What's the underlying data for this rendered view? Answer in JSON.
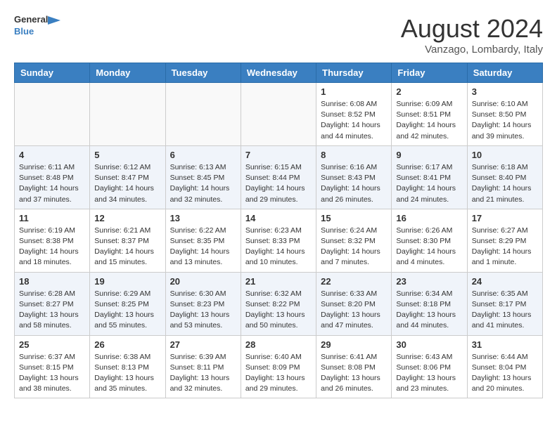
{
  "header": {
    "logo_line1": "General",
    "logo_line2": "Blue",
    "month_year": "August 2024",
    "location": "Vanzago, Lombardy, Italy"
  },
  "weekdays": [
    "Sunday",
    "Monday",
    "Tuesday",
    "Wednesday",
    "Thursday",
    "Friday",
    "Saturday"
  ],
  "weeks": [
    [
      {
        "day": "",
        "info": ""
      },
      {
        "day": "",
        "info": ""
      },
      {
        "day": "",
        "info": ""
      },
      {
        "day": "",
        "info": ""
      },
      {
        "day": "1",
        "info": "Sunrise: 6:08 AM\nSunset: 8:52 PM\nDaylight: 14 hours\nand 44 minutes."
      },
      {
        "day": "2",
        "info": "Sunrise: 6:09 AM\nSunset: 8:51 PM\nDaylight: 14 hours\nand 42 minutes."
      },
      {
        "day": "3",
        "info": "Sunrise: 6:10 AM\nSunset: 8:50 PM\nDaylight: 14 hours\nand 39 minutes."
      }
    ],
    [
      {
        "day": "4",
        "info": "Sunrise: 6:11 AM\nSunset: 8:48 PM\nDaylight: 14 hours\nand 37 minutes."
      },
      {
        "day": "5",
        "info": "Sunrise: 6:12 AM\nSunset: 8:47 PM\nDaylight: 14 hours\nand 34 minutes."
      },
      {
        "day": "6",
        "info": "Sunrise: 6:13 AM\nSunset: 8:45 PM\nDaylight: 14 hours\nand 32 minutes."
      },
      {
        "day": "7",
        "info": "Sunrise: 6:15 AM\nSunset: 8:44 PM\nDaylight: 14 hours\nand 29 minutes."
      },
      {
        "day": "8",
        "info": "Sunrise: 6:16 AM\nSunset: 8:43 PM\nDaylight: 14 hours\nand 26 minutes."
      },
      {
        "day": "9",
        "info": "Sunrise: 6:17 AM\nSunset: 8:41 PM\nDaylight: 14 hours\nand 24 minutes."
      },
      {
        "day": "10",
        "info": "Sunrise: 6:18 AM\nSunset: 8:40 PM\nDaylight: 14 hours\nand 21 minutes."
      }
    ],
    [
      {
        "day": "11",
        "info": "Sunrise: 6:19 AM\nSunset: 8:38 PM\nDaylight: 14 hours\nand 18 minutes."
      },
      {
        "day": "12",
        "info": "Sunrise: 6:21 AM\nSunset: 8:37 PM\nDaylight: 14 hours\nand 15 minutes."
      },
      {
        "day": "13",
        "info": "Sunrise: 6:22 AM\nSunset: 8:35 PM\nDaylight: 14 hours\nand 13 minutes."
      },
      {
        "day": "14",
        "info": "Sunrise: 6:23 AM\nSunset: 8:33 PM\nDaylight: 14 hours\nand 10 minutes."
      },
      {
        "day": "15",
        "info": "Sunrise: 6:24 AM\nSunset: 8:32 PM\nDaylight: 14 hours\nand 7 minutes."
      },
      {
        "day": "16",
        "info": "Sunrise: 6:26 AM\nSunset: 8:30 PM\nDaylight: 14 hours\nand 4 minutes."
      },
      {
        "day": "17",
        "info": "Sunrise: 6:27 AM\nSunset: 8:29 PM\nDaylight: 14 hours\nand 1 minute."
      }
    ],
    [
      {
        "day": "18",
        "info": "Sunrise: 6:28 AM\nSunset: 8:27 PM\nDaylight: 13 hours\nand 58 minutes."
      },
      {
        "day": "19",
        "info": "Sunrise: 6:29 AM\nSunset: 8:25 PM\nDaylight: 13 hours\nand 55 minutes."
      },
      {
        "day": "20",
        "info": "Sunrise: 6:30 AM\nSunset: 8:23 PM\nDaylight: 13 hours\nand 53 minutes."
      },
      {
        "day": "21",
        "info": "Sunrise: 6:32 AM\nSunset: 8:22 PM\nDaylight: 13 hours\nand 50 minutes."
      },
      {
        "day": "22",
        "info": "Sunrise: 6:33 AM\nSunset: 8:20 PM\nDaylight: 13 hours\nand 47 minutes."
      },
      {
        "day": "23",
        "info": "Sunrise: 6:34 AM\nSunset: 8:18 PM\nDaylight: 13 hours\nand 44 minutes."
      },
      {
        "day": "24",
        "info": "Sunrise: 6:35 AM\nSunset: 8:17 PM\nDaylight: 13 hours\nand 41 minutes."
      }
    ],
    [
      {
        "day": "25",
        "info": "Sunrise: 6:37 AM\nSunset: 8:15 PM\nDaylight: 13 hours\nand 38 minutes."
      },
      {
        "day": "26",
        "info": "Sunrise: 6:38 AM\nSunset: 8:13 PM\nDaylight: 13 hours\nand 35 minutes."
      },
      {
        "day": "27",
        "info": "Sunrise: 6:39 AM\nSunset: 8:11 PM\nDaylight: 13 hours\nand 32 minutes."
      },
      {
        "day": "28",
        "info": "Sunrise: 6:40 AM\nSunset: 8:09 PM\nDaylight: 13 hours\nand 29 minutes."
      },
      {
        "day": "29",
        "info": "Sunrise: 6:41 AM\nSunset: 8:08 PM\nDaylight: 13 hours\nand 26 minutes."
      },
      {
        "day": "30",
        "info": "Sunrise: 6:43 AM\nSunset: 8:06 PM\nDaylight: 13 hours\nand 23 minutes."
      },
      {
        "day": "31",
        "info": "Sunrise: 6:44 AM\nSunset: 8:04 PM\nDaylight: 13 hours\nand 20 minutes."
      }
    ]
  ]
}
